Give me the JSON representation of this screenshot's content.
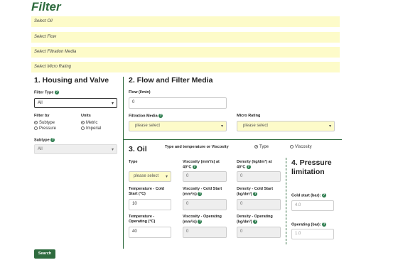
{
  "title": "Filter",
  "bars": [
    "Select Oil",
    "Select Flow",
    "Select Filtration Media",
    "Select Micro Rating"
  ],
  "s1": {
    "heading": "1. Housing and Valve",
    "filter_type_label": "Filter Type",
    "filter_type_value": "All",
    "filter_by_label": "Filter by",
    "filter_by_options": [
      "Subtype",
      "Pressure"
    ],
    "units_label": "Units",
    "units_options": [
      "Metric",
      "Imperial"
    ],
    "subtype_label": "Subtype",
    "subtype_value": "All"
  },
  "s2": {
    "heading": "2. Flow and Filter Media",
    "flow_label": "Flow (l/min)",
    "flow_value": "0",
    "media_label": "Filtration Media",
    "media_value": "please select",
    "micro_label": "Micro Rating",
    "micro_value": "please select"
  },
  "s3": {
    "heading": "3. Oil",
    "type_or_visc": "Type and temperature or Viscosity",
    "opt_type": "Type",
    "opt_visc": "Viscosity",
    "type_label": "Type",
    "type_value": "please select",
    "visc40_label1": "Viscosity (mm²/s) at",
    "visc40_label2": "40°C",
    "visc40_value": "0",
    "dens40_label1": "Density (kg/dm³) at",
    "dens40_label2": "40°C",
    "dens40_value": "0",
    "tcold_label1": "Temperature - Cold",
    "tcold_label2": "Start (°C)",
    "tcold_value": "10",
    "vcold_label1": "Viscosity - Cold Start",
    "vcold_label2": "(mm²/s)",
    "vcold_value": "0",
    "dcold_label1": "Density - Cold Start",
    "dcold_label2": "(kg/dm³)",
    "dcold_value": "0",
    "top_label1": "Temperature -",
    "top_label2": "Operating (°C)",
    "top_value": "40",
    "vop_label1": "Viscosity - Operating",
    "vop_label2": "(mm²/s)",
    "vop_value": "0",
    "dop_label1": "Density - Operating",
    "dop_label2": "(kg/dm³)",
    "dop_value": "0"
  },
  "s4": {
    "heading1": "4. Pressure",
    "heading2": "limitation",
    "cold_label": "Cold start (bar):",
    "cold_value": "4.0",
    "op_label": "Operating (bar):",
    "op_value": "1.0"
  },
  "search_label": "Search"
}
